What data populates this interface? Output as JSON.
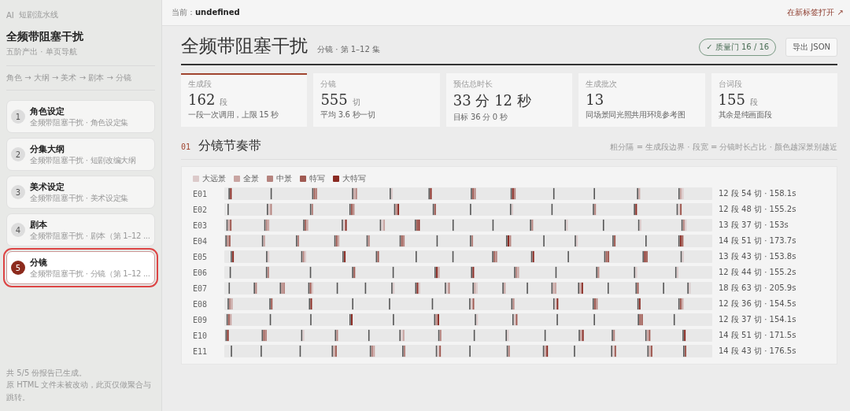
{
  "sidebar": {
    "brand_mark": "AI",
    "brand": "短剧流水线",
    "title": "全频带阻塞干扰",
    "subtitle": "五阶产出 · 单页导航",
    "pipeline": "角色 → 大纲 → 美术 → 剧本 → 分镜",
    "items": [
      {
        "number": "1",
        "title": "角色设定",
        "subtitle": "全频带阻塞干扰 · 角色设定集",
        "selected": false
      },
      {
        "number": "2",
        "title": "分集大纲",
        "subtitle": "全频带阻塞干扰 · 短剧改编大纲",
        "selected": false
      },
      {
        "number": "3",
        "title": "美术设定",
        "subtitle": "全频带阻塞干扰 · 美术设定集",
        "selected": false
      },
      {
        "number": "4",
        "title": "剧本",
        "subtitle": "全频带阻塞干扰 · 剧本（第 1–12 ...",
        "selected": false
      },
      {
        "number": "5",
        "title": "分镜",
        "subtitle": "全频带阻塞干扰 · 分镜（第 1–12 ...",
        "selected": true
      }
    ],
    "footer": [
      "共 5/5 份报告已生成。",
      "原 HTML 文件未被改动，此页仅做聚合与跳转。"
    ]
  },
  "topbar": {
    "current": "当前：**undefined**",
    "open_link": "在新标签打开 ↗"
  },
  "header": {
    "title": "全频带阻塞干扰",
    "subtitle": "分镜 · 第 1–12 集",
    "quality_badge": "✓ 质量门 16 / 16",
    "export_button": "导出 JSON"
  },
  "metrics": [
    {
      "label": "生成段",
      "value": "162",
      "unit": "段",
      "note": "一段一次调用，上限 15 秒",
      "highlighted": true
    },
    {
      "label": "分镜",
      "value": "555",
      "unit": "切",
      "note": "平均 3.6 秒一切",
      "highlighted": false
    },
    {
      "label": "预估总时长",
      "value": "33 分 12 秒",
      "note": "目标 36 分 0 秒",
      "highlighted": false
    },
    {
      "label": "生成批次",
      "value": "13",
      "note": "同场景同光照共用环境参考图",
      "highlighted": false
    },
    {
      "label": "台词段",
      "value": "155",
      "unit": "段",
      "note": "其余是纯画面段",
      "highlighted": false
    }
  ],
  "section": {
    "number": "01",
    "title": "分镜节奏带",
    "note": "粗分隔 = 生成段边界 · 段宽 = 分镜时长占比 · 颜色越深景别越近",
    "legend": [
      {
        "label": "大远景",
        "color": "#dccaca"
      },
      {
        "label": "全景",
        "color": "#c9a5a2"
      },
      {
        "label": "中景",
        "color": "#b5837e"
      },
      {
        "label": "特写",
        "color": "#a05a52"
      },
      {
        "label": "大特写",
        "color": "#8a2a22"
      }
    ],
    "rows": [
      {
        "episode": "E01",
        "stats": "12 段 54 切 · 158.1s"
      },
      {
        "episode": "E02",
        "stats": "12 段 48 切 · 155.2s"
      },
      {
        "episode": "E03",
        "stats": "13 段 37 切 · 153s"
      },
      {
        "episode": "E04",
        "stats": "14 段 51 切 · 173.7s"
      },
      {
        "episode": "E05",
        "stats": "13 段 43 切 · 153.8s"
      },
      {
        "episode": "E06",
        "stats": "12 段 44 切 · 155.2s"
      },
      {
        "episode": "E07",
        "stats": "18 段 63 切 · 205.9s"
      },
      {
        "episode": "E08",
        "stats": "12 段 36 切 · 154.5s"
      },
      {
        "episode": "E09",
        "stats": "12 段 37 切 · 154.1s"
      },
      {
        "episode": "E10",
        "stats": "14 段 51 切 · 171.5s"
      },
      {
        "episode": "E11",
        "stats": "14 段 43 切 · 176.5s"
      }
    ]
  }
}
